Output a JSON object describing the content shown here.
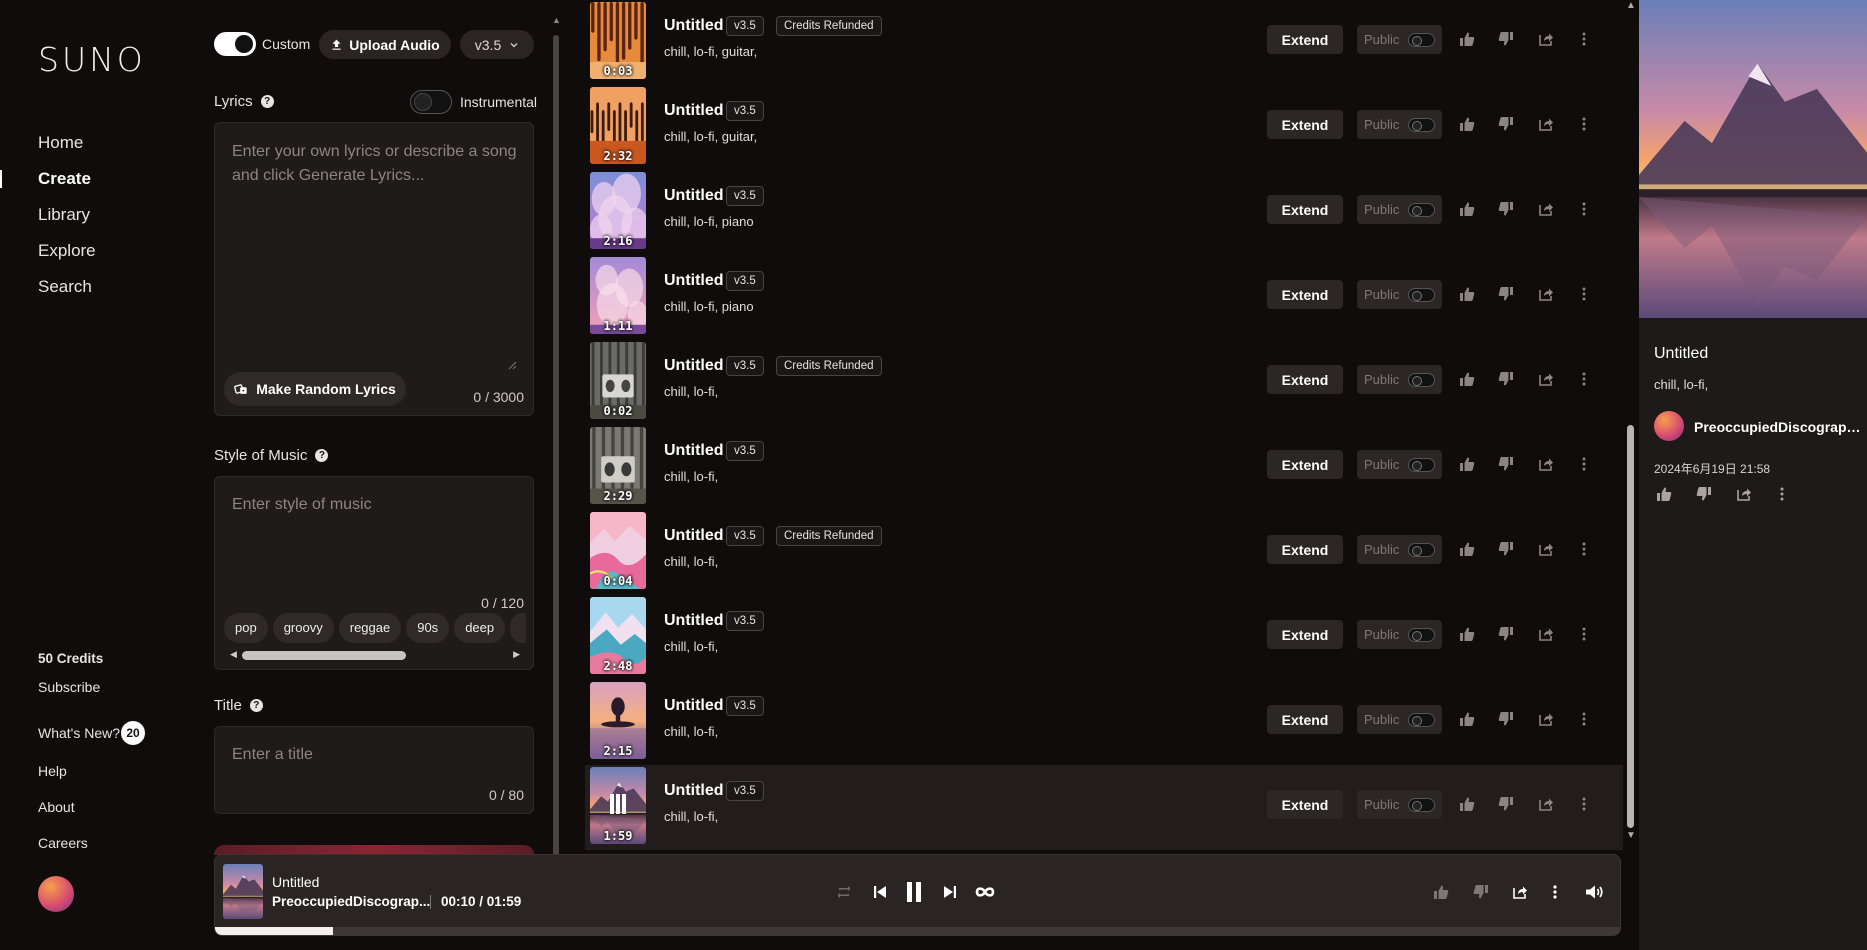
{
  "brand": {
    "logo_text": "SUNO"
  },
  "nav": {
    "items": [
      {
        "label": "Home",
        "active": false
      },
      {
        "label": "Create",
        "active": true
      },
      {
        "label": "Library",
        "active": false
      },
      {
        "label": "Explore",
        "active": false
      },
      {
        "label": "Search",
        "active": false
      }
    ],
    "credits": "50 Credits",
    "subscribe": "Subscribe",
    "whats_new": "What's New?",
    "whats_new_count": "20",
    "help": "Help",
    "about": "About",
    "careers": "Careers"
  },
  "create": {
    "custom_label": "Custom",
    "custom_on": true,
    "upload_label": "Upload Audio",
    "version": "v3.5",
    "lyrics_label": "Lyrics",
    "instrumental_label": "Instrumental",
    "instrumental_on": false,
    "lyrics_placeholder": "Enter your own lyrics or describe a song and click Generate Lyrics...",
    "random_lyrics_label": "Make Random Lyrics",
    "lyrics_counter": "0 / 3000",
    "style_label": "Style of Music",
    "style_placeholder": "Enter style of music",
    "style_counter": "0 / 120",
    "style_chips": [
      "pop",
      "groovy",
      "reggae",
      "90s",
      "deep"
    ],
    "title_label": "Title",
    "title_placeholder": "Enter a title",
    "title_counter": "0 / 80"
  },
  "songs": [
    {
      "title": "Untitled",
      "version": "v3.5",
      "refunded": "Credits Refunded",
      "tags": "chill, lo-fi, guitar,",
      "duration": "0:03",
      "art": "orange-drips",
      "playing": false
    },
    {
      "title": "Untitled",
      "version": "v3.5",
      "refunded": "",
      "tags": "chill, lo-fi, guitar,",
      "duration": "2:32",
      "art": "orange-drips2",
      "playing": false
    },
    {
      "title": "Untitled",
      "version": "v3.5",
      "refunded": "",
      "tags": "chill, lo-fi, piano",
      "duration": "2:16",
      "art": "purple-clouds",
      "playing": false
    },
    {
      "title": "Untitled",
      "version": "v3.5",
      "refunded": "",
      "tags": "chill, lo-fi, piano",
      "duration": "1:11",
      "art": "pink-clouds",
      "playing": false
    },
    {
      "title": "Untitled",
      "version": "v3.5",
      "refunded": "Credits Refunded",
      "tags": "chill, lo-fi,",
      "duration": "0:02",
      "art": "forest-boombox",
      "playing": false
    },
    {
      "title": "Untitled",
      "version": "v3.5",
      "refunded": "",
      "tags": "chill, lo-fi,",
      "duration": "2:29",
      "art": "forest-boombox2",
      "playing": false
    },
    {
      "title": "Untitled",
      "version": "v3.5",
      "refunded": "Credits Refunded",
      "tags": "chill, lo-fi,",
      "duration": "0:04",
      "art": "pastel-mountains",
      "playing": false
    },
    {
      "title": "Untitled",
      "version": "v3.5",
      "refunded": "",
      "tags": "chill, lo-fi,",
      "duration": "2:48",
      "art": "pastel-mountains2",
      "playing": false
    },
    {
      "title": "Untitled",
      "version": "v3.5",
      "refunded": "",
      "tags": "chill, lo-fi,",
      "duration": "2:15",
      "art": "sunset-lake",
      "playing": false
    },
    {
      "title": "Untitled",
      "version": "v3.5",
      "refunded": "",
      "tags": "chill, lo-fi,",
      "duration": "1:59",
      "art": "mountain-lake",
      "playing": true
    }
  ],
  "song_actions": {
    "extend_label": "Extend",
    "public_label": "Public"
  },
  "detail": {
    "title": "Untitled",
    "tags": "chill, lo-fi,",
    "user": "PreoccupiedDiscographi...",
    "date": "2024年6月19日 21:58"
  },
  "player": {
    "title": "Untitled",
    "user": "PreoccupiedDiscograp...",
    "time": "00:10 / 01:59",
    "progress": 0.084
  },
  "colors": {
    "background": "#100c0c",
    "panel": "#1f1b1a",
    "accent_create": "#8a2633"
  }
}
